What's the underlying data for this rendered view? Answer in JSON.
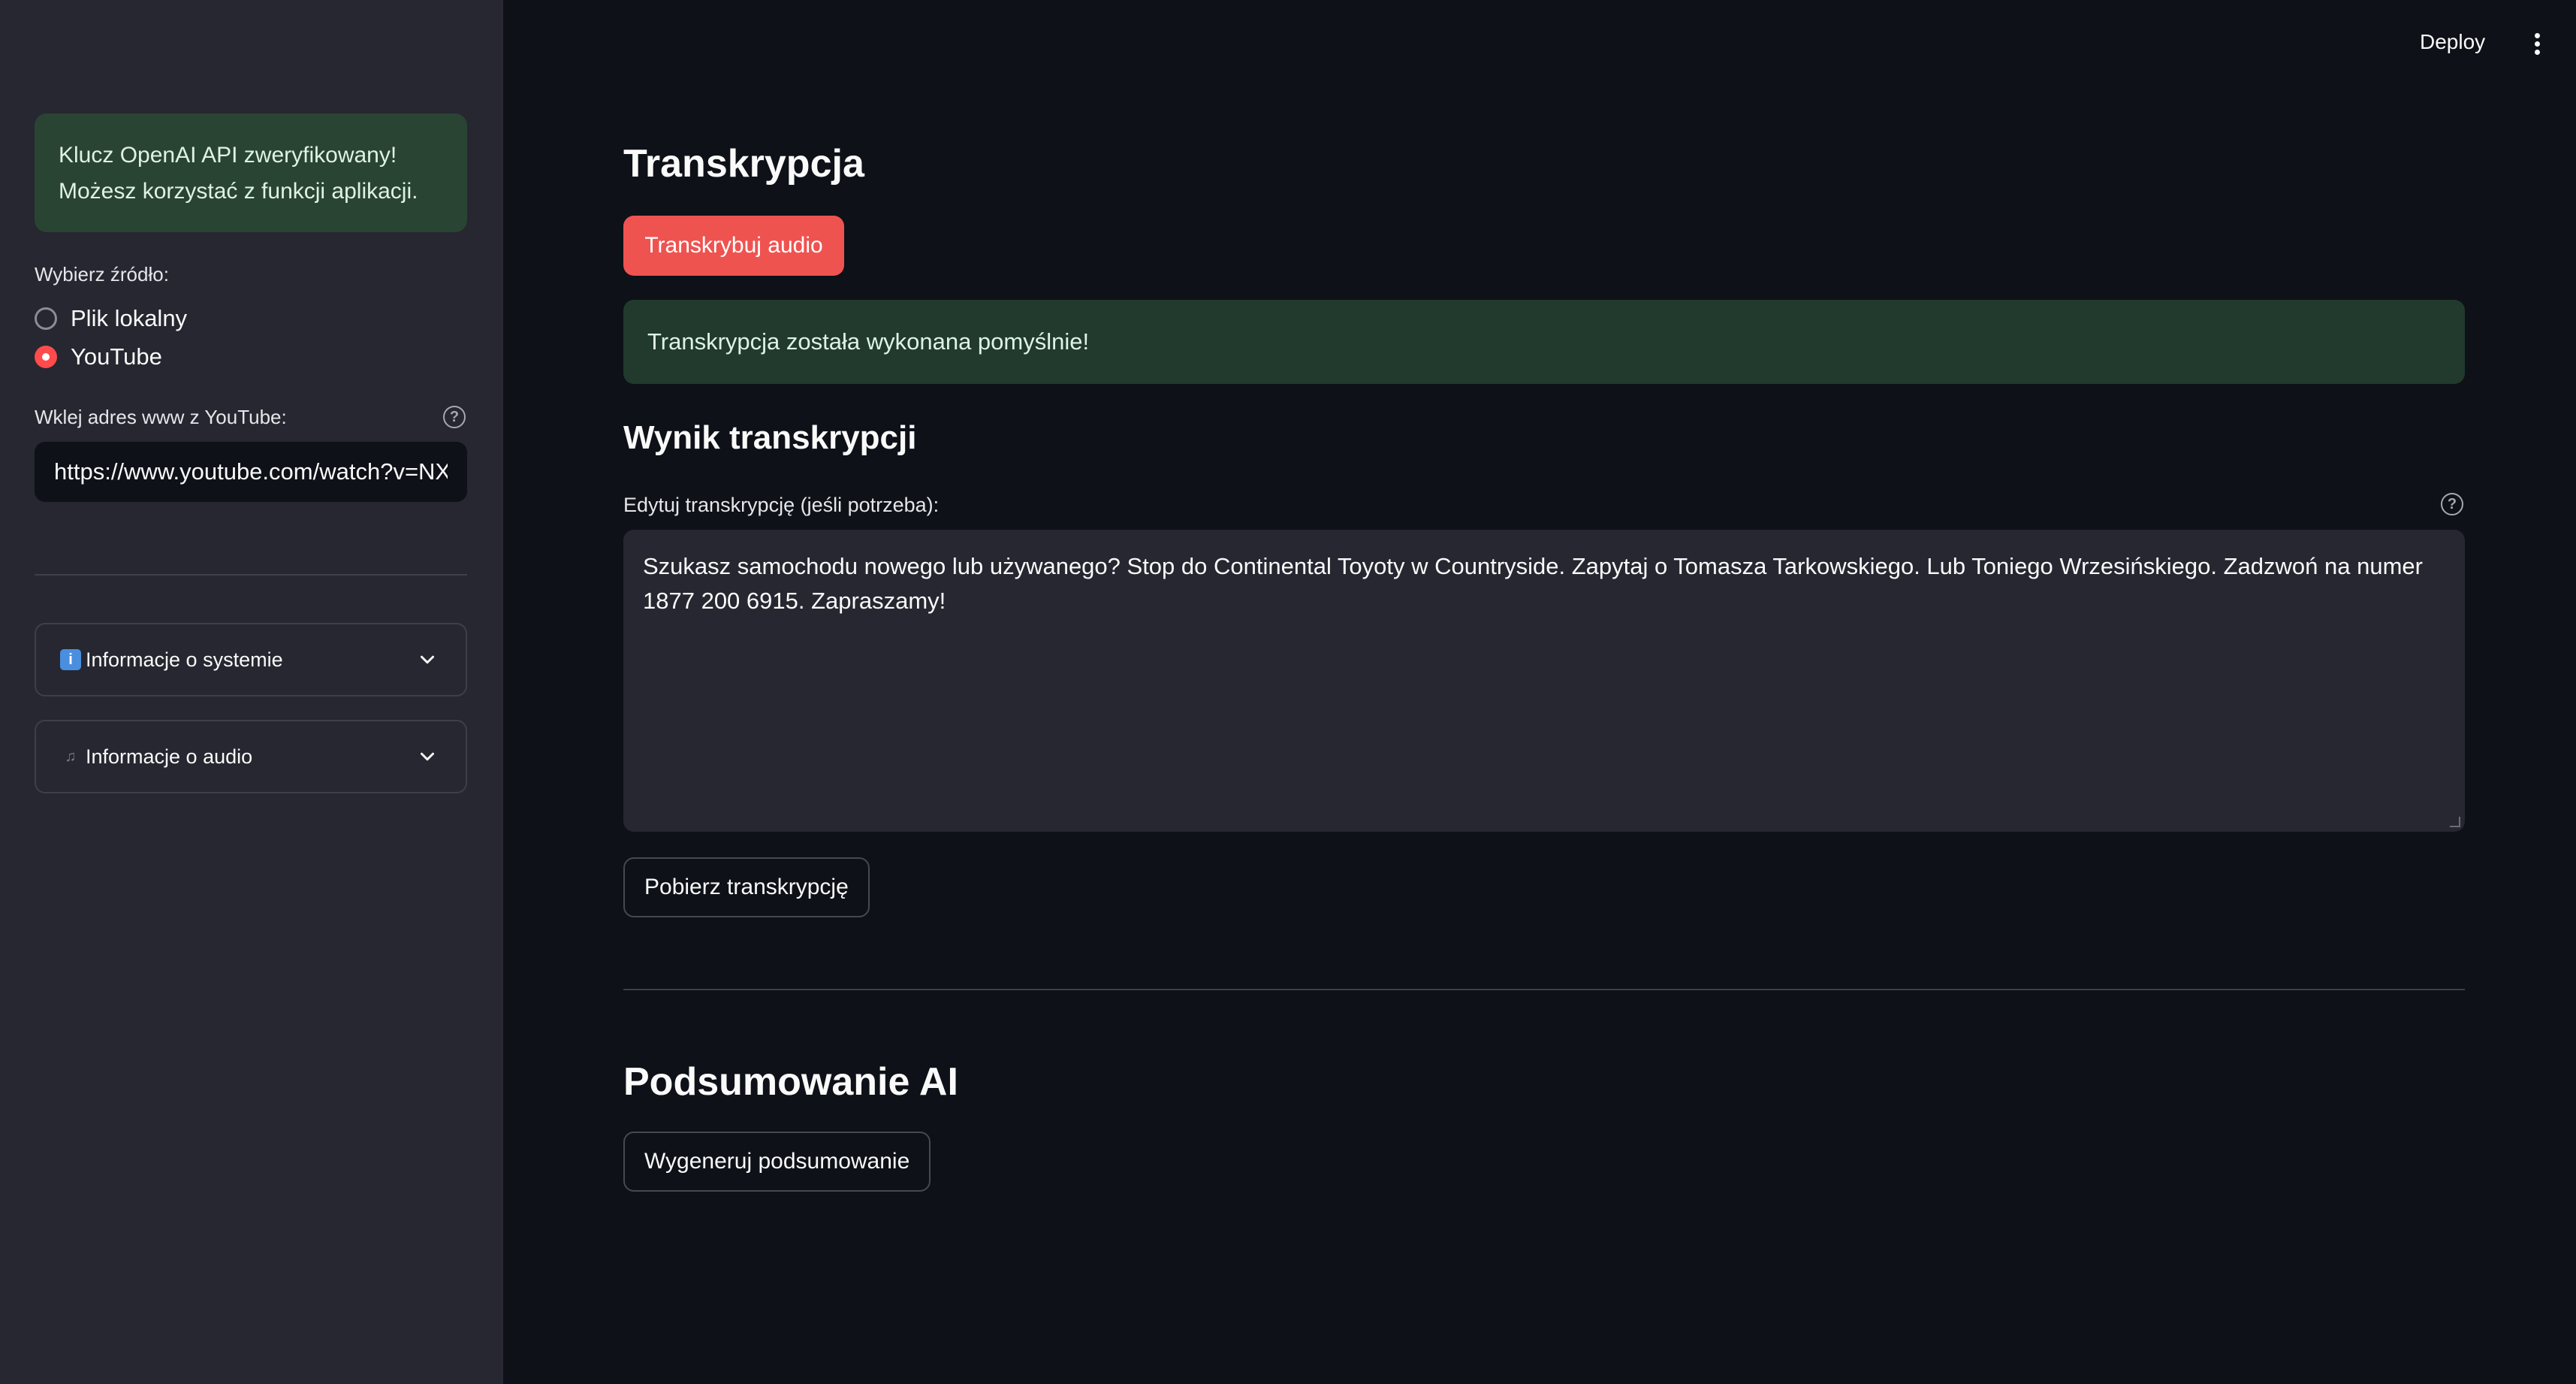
{
  "sidebar": {
    "api_status": {
      "line1": "Klucz OpenAI API zweryfikowany!",
      "line2": "Możesz korzystać z funkcji aplikacji."
    },
    "source": {
      "label": "Wybierz źródło:",
      "options": [
        "Plik lokalny",
        "YouTube"
      ],
      "selected": "YouTube"
    },
    "youtube": {
      "label": "Wklej adres www z YouTube:",
      "value": "https://www.youtube.com/watch?v=NXI"
    },
    "expanders": [
      {
        "icon": "info-icon",
        "label": "Informacje o systemie"
      },
      {
        "icon": "music-note-icon",
        "label": "Informacje o audio"
      }
    ]
  },
  "header": {
    "deploy_label": "Deploy"
  },
  "main": {
    "transcription_title": "Transkrypcja",
    "transcribe_button": "Transkrybuj audio",
    "success_message": "Transkrypcja została wykonana pomyślnie!",
    "result_title": "Wynik transkrypcji",
    "edit_label": "Edytuj transkrypcję (jeśli potrzeba):",
    "transcript_text": "Szukasz samochodu nowego lub używanego? Stop do Continental Toyoty w Countryside. Zapytaj o Tomasza Tarkowskiego. Lub Toniego Wrzesińskiego. Zadzwoń na numer 1877 200 6915. Zapraszamy!",
    "download_button": "Pobierz transkrypcję",
    "summary_title": "Podsumowanie AI",
    "summary_button": "Wygeneruj podsumowanie"
  },
  "colors": {
    "background": "#0e1117",
    "sidebar": "#262730",
    "primary": "#ff4b4b",
    "success_bg": "#213a2d"
  }
}
